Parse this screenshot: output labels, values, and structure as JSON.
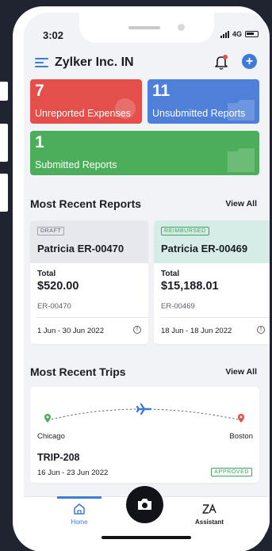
{
  "status": {
    "time": "3:02",
    "network": "4G"
  },
  "header": {
    "org_name": "Zylker Inc. IN"
  },
  "summary": {
    "unreported": {
      "count": "7",
      "label": "Unreported Expenses",
      "color": "#e44e4b"
    },
    "unsubmitted": {
      "count": "11",
      "label": "Unsubmitted Reports",
      "color": "#4e7fd9"
    },
    "submitted": {
      "count": "1",
      "label": "Submitted Reports",
      "color": "#4cae5a"
    }
  },
  "recent_reports": {
    "title": "Most Recent Reports",
    "view_all": "View All",
    "items": [
      {
        "status": "DRAFT",
        "name": "Patricia ER-00470",
        "total_label": "Total",
        "amount": "$520.00",
        "report_id": "ER-00470",
        "date_range": "1 Jun - 30 Jun 2022",
        "head_color": "#e6e8ee"
      },
      {
        "status": "REIMBURSED",
        "name": "Patricia ER-00469",
        "total_label": "Total",
        "amount": "$15,188.01",
        "report_id": "ER-00469",
        "date_range": "18 Jun - 18 Jun 2022",
        "head_color": "#d5ede6"
      }
    ]
  },
  "recent_trips": {
    "title": "Most Recent Trips",
    "view_all": "View All",
    "items": [
      {
        "from": "Chicago",
        "to": "Boston",
        "trip_id": "TRIP-208",
        "date_range": "16 Jun - 23 Jun 2022",
        "status": "APPROVED"
      }
    ]
  },
  "tabbar": {
    "home_label": "Home",
    "assistant_label": "Assistant"
  },
  "icons": {
    "menu": "menu-icon",
    "bell": "bell-icon",
    "add": "plus-icon",
    "camera": "camera-icon",
    "home": "home-icon",
    "assistant": "zia-assistant-icon",
    "plane": "plane-icon",
    "info": "info-icon"
  }
}
